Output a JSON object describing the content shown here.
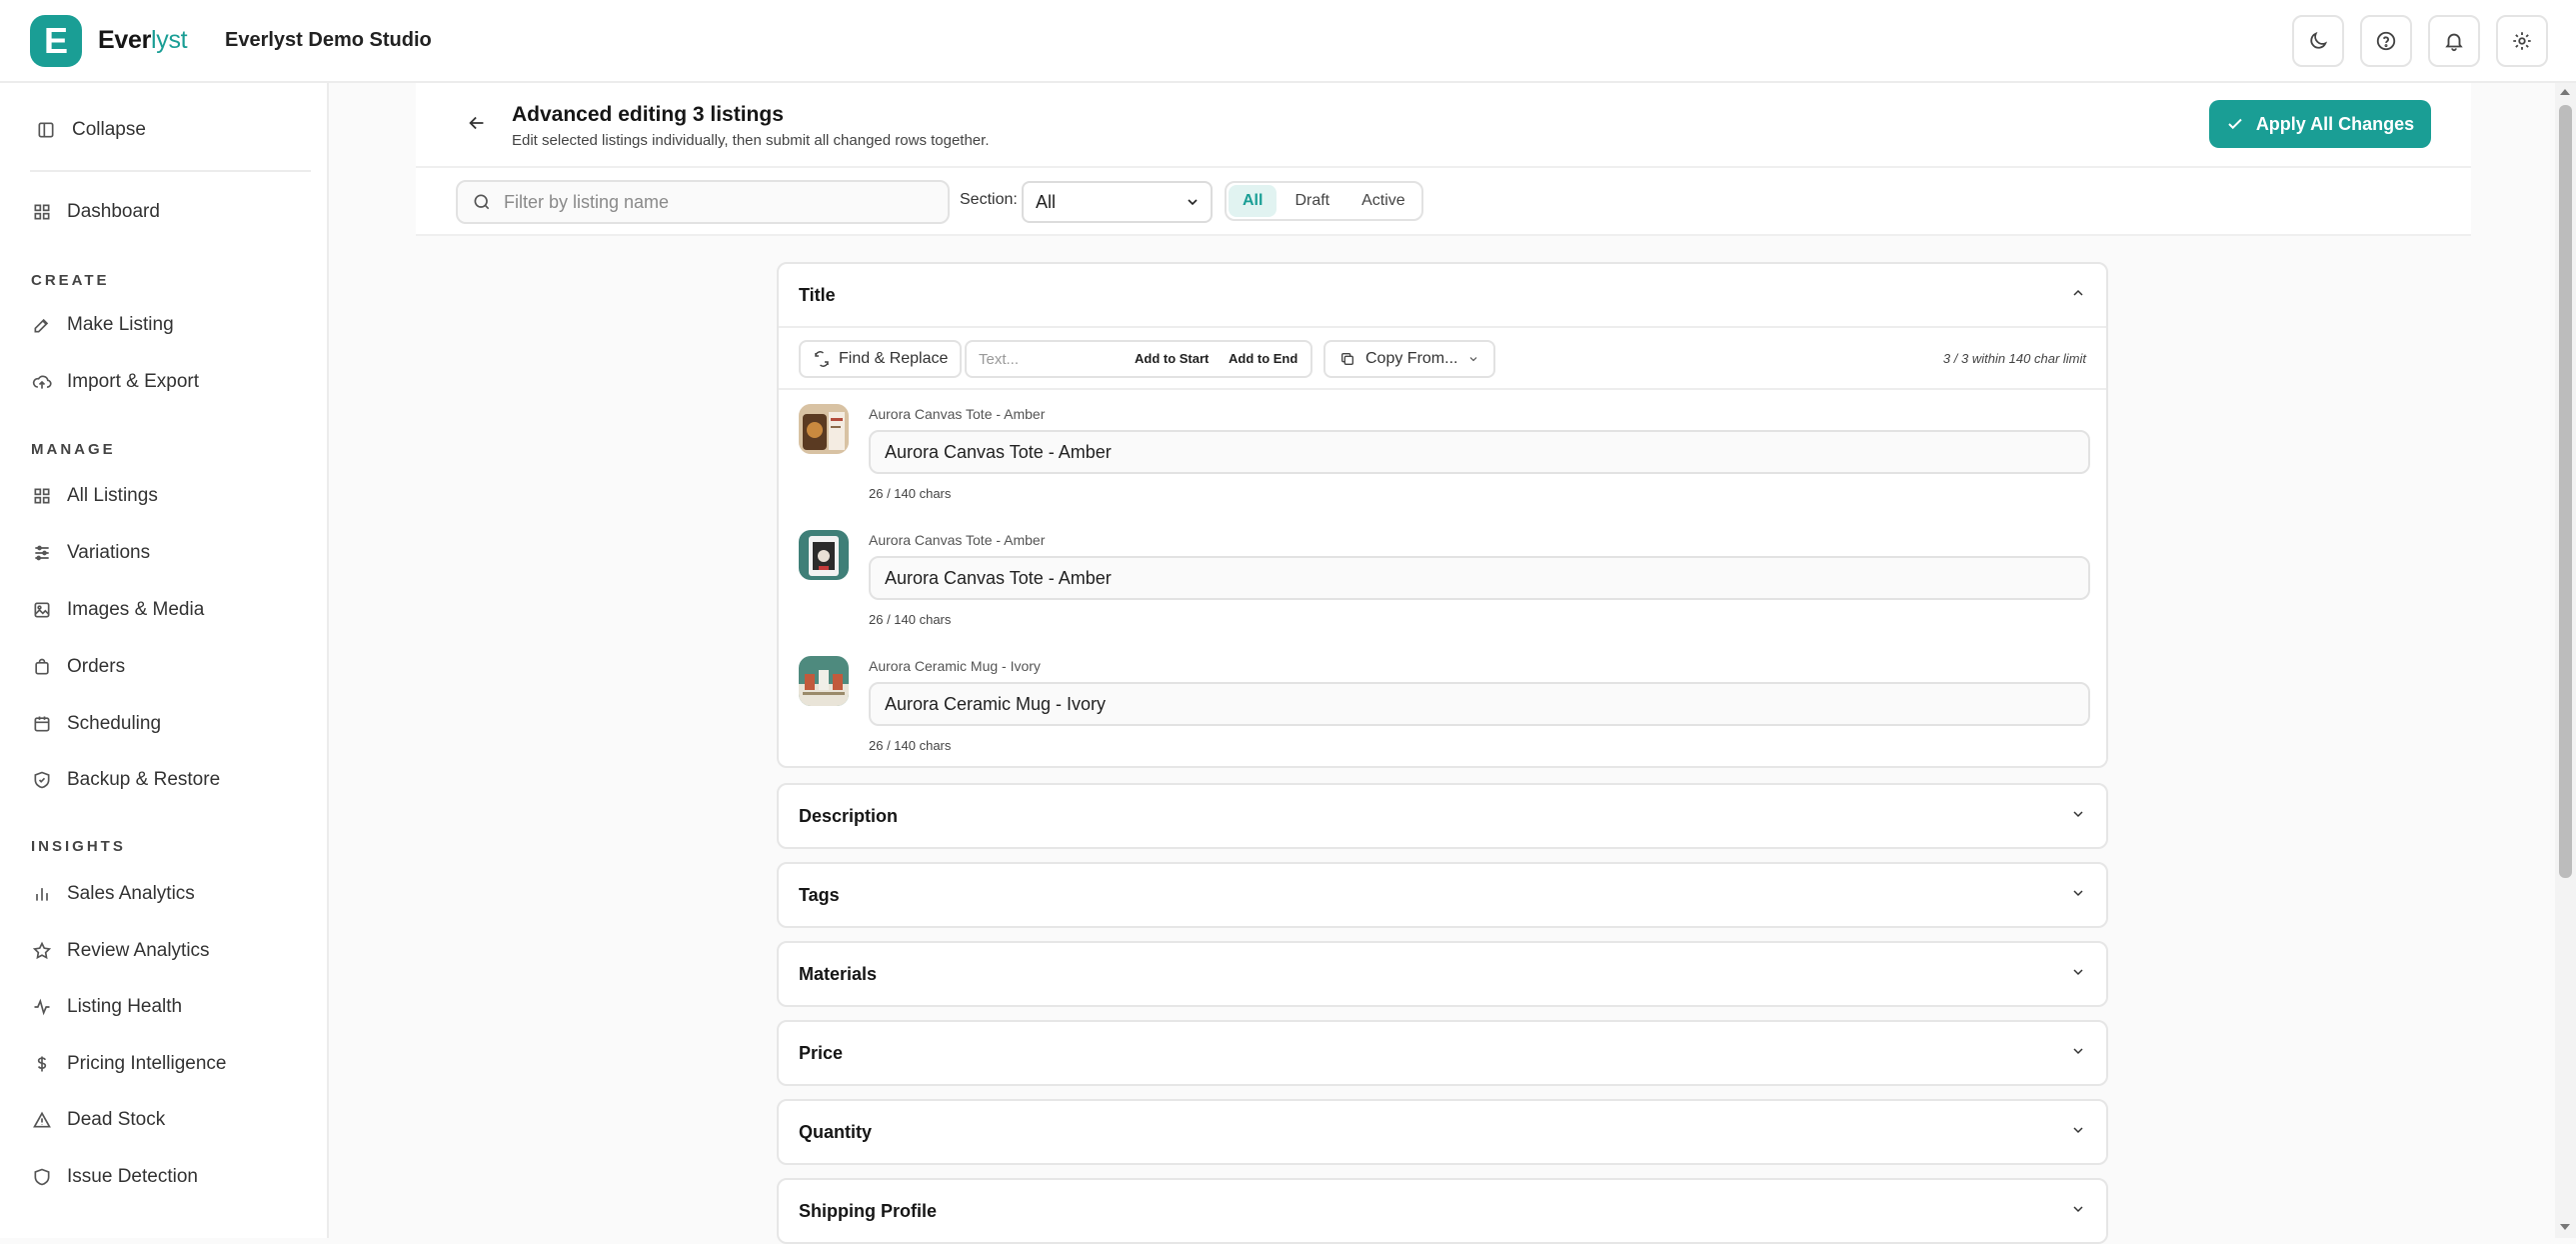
{
  "app": {
    "brand_initial": "E",
    "brand_name_a": "Ever",
    "brand_name_b": "lyst",
    "studio": "Everlyst Demo Studio",
    "accent": "#1a9e95"
  },
  "top_icons": [
    "moon-icon",
    "help-icon",
    "bell-icon",
    "gear-icon"
  ],
  "sidebar": {
    "collapse": "Collapse",
    "dashboard": "Dashboard",
    "sections": {
      "create": "CREATE",
      "manage": "MANAGE",
      "insights": "INSIGHTS"
    },
    "create": [
      "Make Listing",
      "Import & Export"
    ],
    "manage": [
      "All Listings",
      "Variations",
      "Images & Media",
      "Orders",
      "Scheduling",
      "Backup & Restore"
    ],
    "insights": [
      "Sales Analytics",
      "Review Analytics",
      "Listing Health",
      "Pricing Intelligence",
      "Dead Stock",
      "Issue Detection"
    ]
  },
  "header": {
    "title": "Advanced editing 3 listings",
    "subtitle": "Edit selected listings individually, then submit all changed rows together.",
    "apply": "Apply All Changes"
  },
  "filters": {
    "search_placeholder": "Filter by listing name",
    "section_label": "Section:",
    "section_value": "All",
    "segments": [
      "All",
      "Draft",
      "Active"
    ],
    "active_segment": "All"
  },
  "title_card": {
    "title": "Title",
    "find_replace": "Find & Replace",
    "text_placeholder": "Text...",
    "add_start": "Add to Start",
    "add_end": "Add to End",
    "copy_from": "Copy From...",
    "limit_note": "3 / 3 within 140 char limit",
    "rows": [
      {
        "label": "Aurora Canvas Tote - Amber",
        "value": "Aurora Canvas Tote - Amber",
        "count": "26 / 140 chars"
      },
      {
        "label": "Aurora Canvas Tote - Amber",
        "value": "Aurora Canvas Tote - Amber",
        "count": "26 / 140 chars"
      },
      {
        "label": "Aurora Ceramic Mug - Ivory",
        "value": "Aurora Ceramic Mug - Ivory",
        "count": "26 / 140 chars"
      }
    ]
  },
  "collapsed_cards": [
    "Description",
    "Tags",
    "Materials",
    "Price",
    "Quantity",
    "Shipping Profile"
  ]
}
